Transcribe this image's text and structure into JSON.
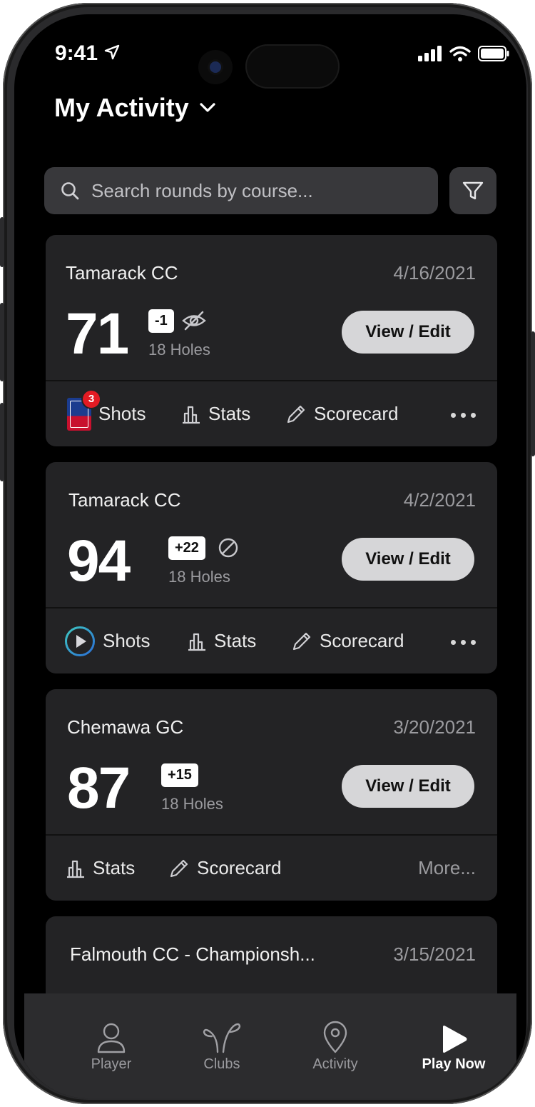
{
  "status_bar": {
    "time": "9:41"
  },
  "header": {
    "title": "My Activity"
  },
  "search": {
    "placeholder": "Search rounds by course..."
  },
  "rounds": [
    {
      "course": "Tamarack CC",
      "date": "4/16/2021",
      "score": "71",
      "to_par": "-1",
      "holes": "18 Holes",
      "view_label": "View / Edit",
      "shots_label": "Shots",
      "shots_count": "3",
      "stats_label": "Stats",
      "scorecard_label": "Scorecard"
    },
    {
      "course": "Tamarack CC",
      "date": "4/2/2021",
      "score": "94",
      "to_par": "+22",
      "holes": "18 Holes",
      "view_label": "View / Edit",
      "shots_label": "Shots",
      "stats_label": "Stats",
      "scorecard_label": "Scorecard"
    },
    {
      "course": "Chemawa GC",
      "date": "3/20/2021",
      "score": "87",
      "to_par": "+15",
      "holes": "18 Holes",
      "view_label": "View / Edit",
      "stats_label": "Stats",
      "scorecard_label": "Scorecard",
      "more_label": "More..."
    },
    {
      "course": "Falmouth CC - Championsh...",
      "date": "3/15/2021"
    }
  ],
  "tabbar": {
    "items": [
      {
        "label": "Player",
        "icon": "person-icon"
      },
      {
        "label": "Clubs",
        "icon": "clubs-icon"
      },
      {
        "label": "Activity",
        "icon": "location-pin-icon"
      },
      {
        "label": "Play Now",
        "icon": "play-icon",
        "active": true
      }
    ]
  },
  "colors": {
    "background": "#000000",
    "card": "#232325",
    "badge_red": "#e31b23",
    "button": "#d6d6d8"
  }
}
